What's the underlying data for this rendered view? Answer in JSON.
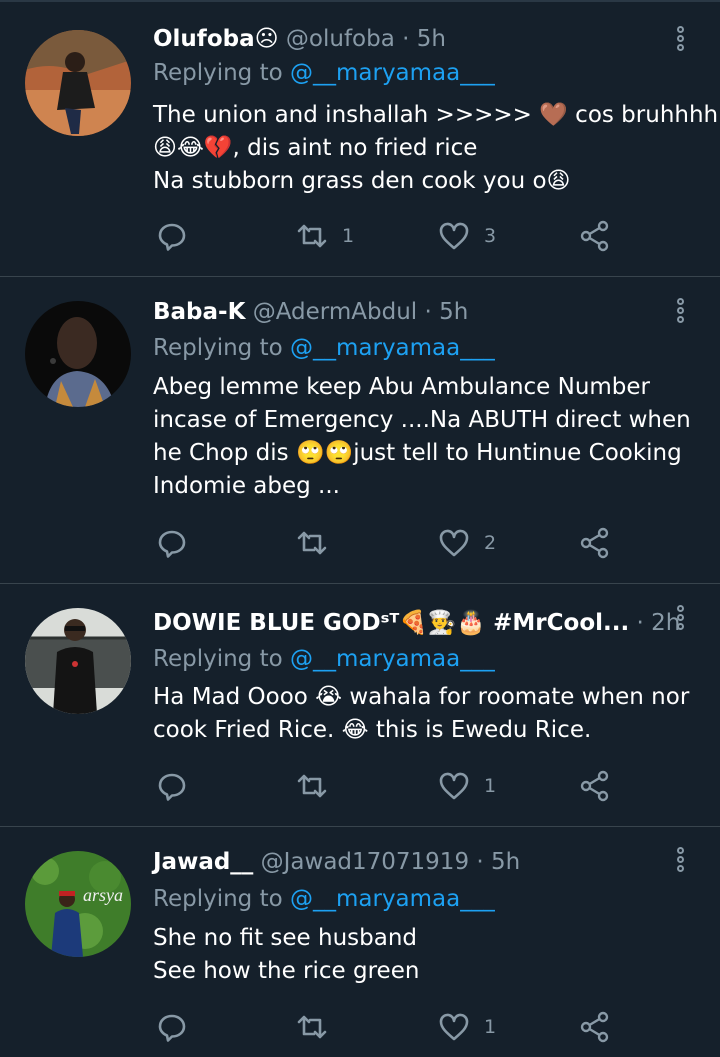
{
  "tweets": [
    {
      "name": "Olufoba☹",
      "handle": "@olufoba",
      "time": "· 5h",
      "replying_label": "Replying to",
      "replying_to": "@__maryamaa___",
      "lines": [
        "The union and inshallah >>>>> 🤎 cos bruhhhh",
        "😩😂💔, dis aint no fried rice",
        "Na stubborn grass den cook you o😩"
      ],
      "retweets": "1",
      "likes": "3"
    },
    {
      "name": "Baba-K",
      "handle": "@AdermAbdul",
      "time": "· 5h",
      "replying_label": "Replying to",
      "replying_to": "@__maryamaa___",
      "lines": [
        "Abeg lemme keep Abu Ambulance Number",
        "incase of Emergency ....Na ABUTH direct  when",
        "he Chop dis 🙄🙄just tell to Huntinue Cooking",
        "Indomie abeg ..."
      ],
      "retweets": "",
      "likes": "2"
    },
    {
      "name": "DOWIE BLUE GODˢᵀ🍕👨‍🍳🎂 #MrCool...",
      "handle": "",
      "time": "· 2h",
      "replying_label": "Replying to",
      "replying_to": "@__maryamaa___",
      "lines": [
        "Ha Mad Oooo 😭 wahala for roomate when nor",
        "cook Fried Rice. 😂 this is Ewedu Rice."
      ],
      "retweets": "",
      "likes": "1"
    },
    {
      "name": "Jawad__",
      "handle": "@Jawad17071919",
      "time": "· 5h",
      "replying_label": "Replying to",
      "replying_to": "@__maryamaa___",
      "lines": [
        "She no fit see husband",
        "See how the rice green"
      ],
      "retweets": "",
      "likes": "1"
    }
  ],
  "colors": {
    "background": "#15202b",
    "secondary_text": "#8899a6",
    "mention": "#1da1f2",
    "divider": "#38444d"
  },
  "icons": [
    "reply-icon",
    "retweet-icon",
    "like-icon",
    "share-icon",
    "more-icon"
  ]
}
